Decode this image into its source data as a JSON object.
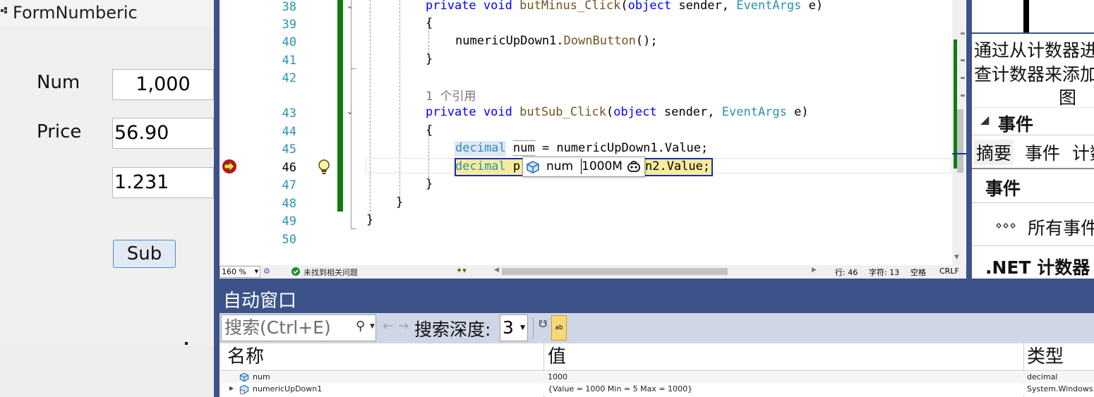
{
  "form": {
    "title": "FormNumberic",
    "num_label": "Num",
    "num_value": "1,000",
    "price_label": "Price",
    "price_value": "56.90",
    "third_value": "1.231",
    "sub_button": "Sub"
  },
  "editor": {
    "lines": [
      {
        "no": "38"
      },
      {
        "no": "39"
      },
      {
        "no": "40"
      },
      {
        "no": "41"
      },
      {
        "no": "42"
      },
      {
        "no": "43"
      },
      {
        "no": "44"
      },
      {
        "no": "45"
      },
      {
        "no": "46"
      },
      {
        "no": "47"
      },
      {
        "no": "48"
      },
      {
        "no": "49"
      },
      {
        "no": "50"
      }
    ],
    "code": {
      "l38_kw1": "private",
      "l38_kw2": "void",
      "l38_name": "butMinus_Click",
      "l38_kw3": "object",
      "l38_p1": "sender,",
      "l38_type": "EventArgs",
      "l38_p2": "e)",
      "l39": "{",
      "l40_obj": "numericUpDown1.",
      "l40_method": "DownButton",
      "l40_tail": "();",
      "l41": "}",
      "ref_count": "1 个引用",
      "l43_kw1": "private",
      "l43_kw2": "void",
      "l43_name": "butSub_Click",
      "l43_kw3": "object",
      "l43_p1": "sender,",
      "l43_type": "EventArgs",
      "l43_p2": "e)",
      "l44": "{",
      "l45_type": "decimal",
      "l45_var": "num",
      "l45_rest": " = numericUpDown1.Value;",
      "l46_type": "decimal",
      "l46_start": "p",
      "l46_end": "n2.Value;",
      "l47": "}",
      "l48": "}",
      "l49": "}"
    },
    "datatip": {
      "name": "num",
      "value": "1000M"
    }
  },
  "status": {
    "zoom": "160 %",
    "issues": "未找到相关问题",
    "line": "行: 46",
    "char": "字符: 13",
    "whitespace": "空格",
    "eol": "CRLF"
  },
  "right_panel": {
    "text1": "通过从计数器进",
    "text2": "查计数器来添加",
    "text3": "图",
    "events_header": "事件",
    "tab_summary": "摘要",
    "tab_events": "事件",
    "tab_counters": "计数",
    "events_section": "事件",
    "all_events": "所有事件",
    "net_counters": ".NET 计数器"
  },
  "autos": {
    "title": "自动窗口",
    "search_placeholder": "搜索(Ctrl+E)",
    "depth_label": "搜索深度:",
    "depth_value": "3",
    "columns": {
      "name": "名称",
      "value": "值",
      "type": "类型"
    },
    "rows": [
      {
        "name": "num",
        "value": "1000",
        "type": "decimal"
      },
      {
        "name": "numericUpDown1",
        "value": "{Value = 1000 Min = 5 Max = 1000}",
        "type": "System.Windows.I"
      }
    ]
  },
  "colors": {
    "vs_blue": "#3c5288",
    "keyword": "#0000ff",
    "type": "#2b91af",
    "change_green": "#107c10",
    "highlight": "#f7ec9c"
  },
  "icons": [
    "form-icon",
    "breakpoint-arrow-icon",
    "lightbulb-icon",
    "fold-icon",
    "variable-icon",
    "copilot-icon",
    "check-icon",
    "search-icon",
    "pin-icon",
    "expand-icon",
    "chevron-down-icon"
  ]
}
